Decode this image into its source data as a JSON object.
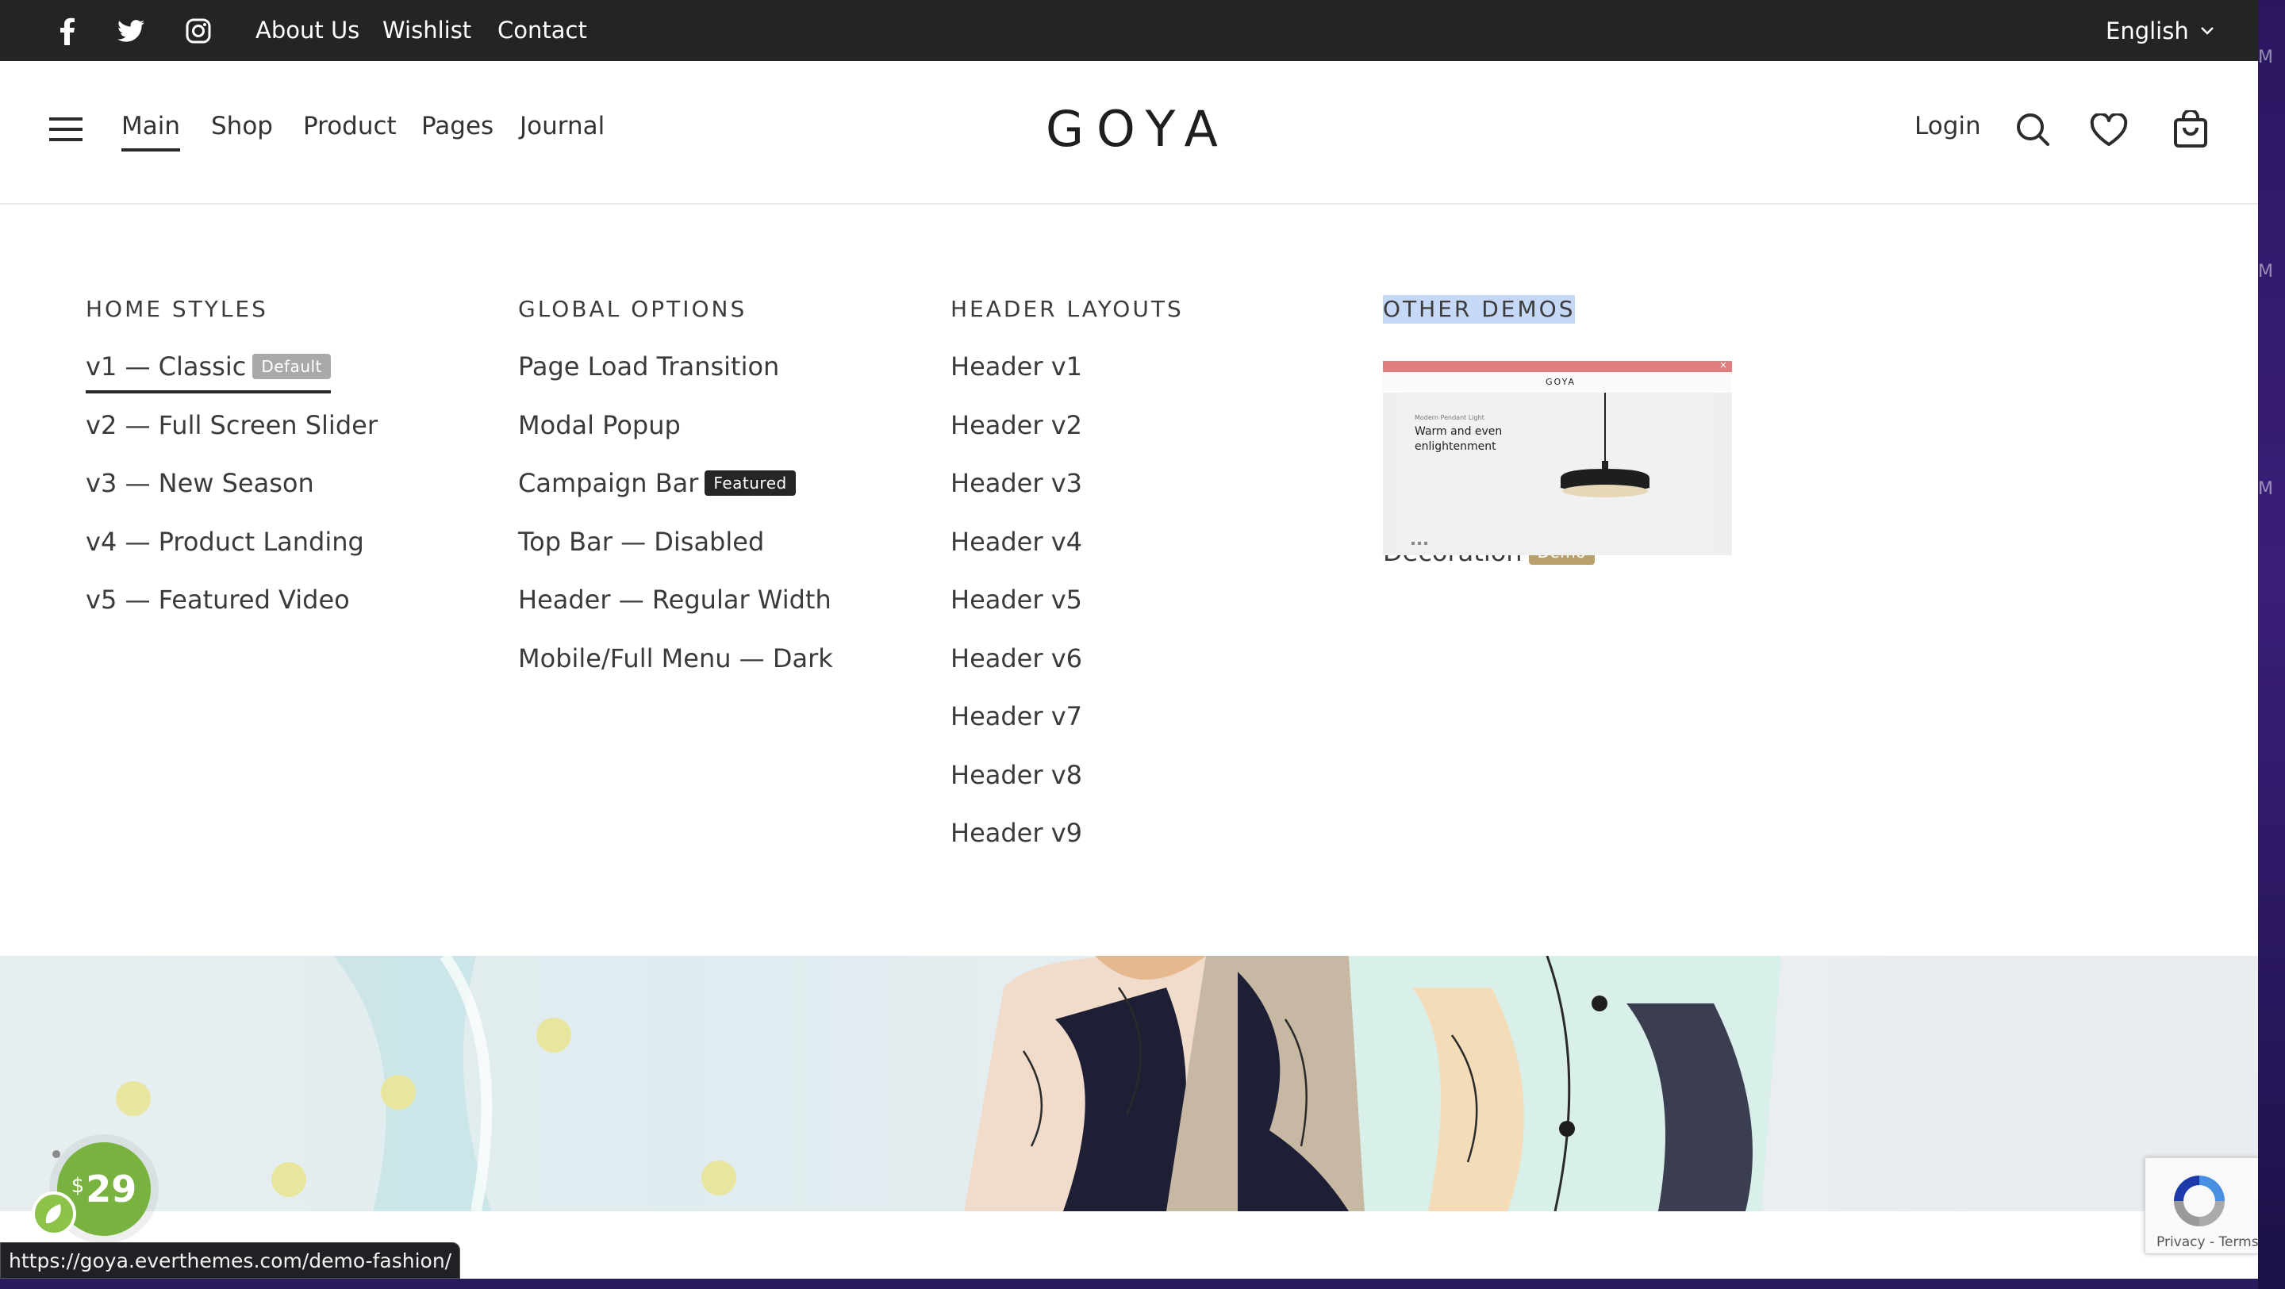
{
  "topbar": {
    "social_icons": [
      "facebook-icon",
      "twitter-icon",
      "instagram-icon"
    ],
    "links": [
      "About Us",
      "Wishlist",
      "Contact"
    ],
    "language": "English"
  },
  "header": {
    "nav": [
      "Main",
      "Shop",
      "Product",
      "Pages",
      "Journal"
    ],
    "active_nav": "Main",
    "logo": "GOYA",
    "login": "Login",
    "icons": [
      "menu-icon",
      "search-icon",
      "heart-icon",
      "cart-icon"
    ]
  },
  "mega_menu": {
    "home_styles": {
      "title": "HOME STYLES",
      "items": [
        "v1 — Classic",
        "v2 — Full Screen Slider",
        "v3 — New Season",
        "v4 — Product Landing",
        "v5 — Featured Video"
      ],
      "badge": "Default"
    },
    "global_options": {
      "title": "GLOBAL OPTIONS",
      "items": [
        "Page Load Transition",
        "Modal Popup",
        "Campaign Bar",
        "Top Bar — Disabled",
        "Header — Regular Width",
        "Mobile/Full Menu — Dark"
      ],
      "badge": "Featured"
    },
    "header_layouts": {
      "title": "HEADER LAYOUTS",
      "items": [
        "Header v1",
        "Header v2",
        "Header v3",
        "Header v4",
        "Header v5",
        "Header v6",
        "Header v7",
        "Header v8",
        "Header v9"
      ]
    },
    "other_demos": {
      "title": "OTHER DEMOS",
      "demo_label": "Decoration",
      "badge": "Demo",
      "thumb": {
        "logo": "GOYA",
        "small": "Modern Pendant Light",
        "headline": "Warm and even enlightenment"
      }
    }
  },
  "colors": {
    "topbar_bg": "#242424",
    "badge_default": "#a9a9a9",
    "badge_featured": "#262626",
    "badge_demo": "#b7a06b",
    "price_green": "#79b33f",
    "selection_blue": "#c5d8f6"
  },
  "price_badge": {
    "currency": "$",
    "amount": "29"
  },
  "recaptcha": {
    "text": "Privacy - Terms"
  },
  "status_url": "https://goya.everthemes.com/demo-fashion/"
}
